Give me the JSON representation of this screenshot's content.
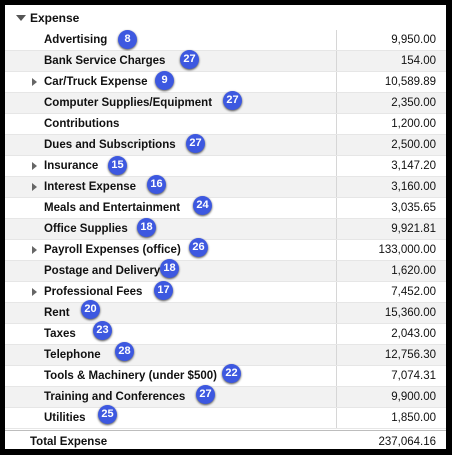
{
  "section": {
    "title": "Expense"
  },
  "rows": [
    {
      "label": "Advertising",
      "amount": "9,950.00",
      "badge": "8",
      "expandable": false
    },
    {
      "label": "Bank Service Charges",
      "amount": "154.00",
      "badge": "27",
      "expandable": false
    },
    {
      "label": "Car/Truck Expense",
      "amount": "10,589.89",
      "badge": "9",
      "expandable": true
    },
    {
      "label": "Computer Supplies/Equipment",
      "amount": "2,350.00",
      "badge": "27",
      "expandable": false
    },
    {
      "label": "Contributions",
      "amount": "1,200.00",
      "badge": "",
      "expandable": false
    },
    {
      "label": "Dues and Subscriptions",
      "amount": "2,500.00",
      "badge": "27",
      "expandable": false
    },
    {
      "label": "Insurance",
      "amount": "3,147.20",
      "badge": "15",
      "expandable": true
    },
    {
      "label": "Interest Expense",
      "amount": "3,160.00",
      "badge": "16",
      "expandable": true
    },
    {
      "label": "Meals and Entertainment",
      "amount": "3,035.65",
      "badge": "24",
      "expandable": false
    },
    {
      "label": "Office Supplies",
      "amount": "9,921.81",
      "badge": "18",
      "expandable": false
    },
    {
      "label": "Payroll Expenses (office)",
      "amount": "133,000.00",
      "badge": "26",
      "expandable": true
    },
    {
      "label": "Postage and Delivery",
      "amount": "1,620.00",
      "badge": "18",
      "expandable": false
    },
    {
      "label": "Professional Fees",
      "amount": "7,452.00",
      "badge": "17",
      "expandable": true
    },
    {
      "label": "Rent",
      "amount": "15,360.00",
      "badge": "20",
      "expandable": false
    },
    {
      "label": "Taxes",
      "amount": "2,043.00",
      "badge": "23",
      "expandable": false
    },
    {
      "label": "Telephone",
      "amount": "12,756.30",
      "badge": "28",
      "expandable": false
    },
    {
      "label": "Tools & Machinery (under $500)",
      "amount": "7,074.31",
      "badge": "22",
      "expandable": false
    },
    {
      "label": "Training and Conferences",
      "amount": "9,900.00",
      "badge": "27",
      "expandable": false
    },
    {
      "label": "Utilities",
      "amount": "1,850.00",
      "badge": "25",
      "expandable": false
    }
  ],
  "total": {
    "label": "Total Expense",
    "amount": "237,064.16"
  },
  "colors": {
    "badge": "#3d58e0",
    "stripe": "#f2f2f2"
  }
}
